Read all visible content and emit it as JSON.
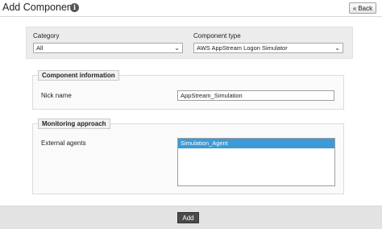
{
  "header": {
    "title": "Add Component",
    "info_icon": "i",
    "back_label": "Back",
    "back_icon": "«"
  },
  "filters": {
    "category_label": "Category",
    "category_value": "All",
    "type_label": "Component type",
    "type_value": "AWS AppStream Logon Simulator",
    "chevron": "⌄"
  },
  "component_info": {
    "legend": "Component information",
    "nickname_label": "Nick name",
    "nickname_value": "AppStream_Simulation"
  },
  "monitoring": {
    "legend": "Monitoring approach",
    "agents_label": "External agents",
    "agents": [
      "Simulation_Agent"
    ]
  },
  "footer": {
    "add_label": "Add"
  }
}
